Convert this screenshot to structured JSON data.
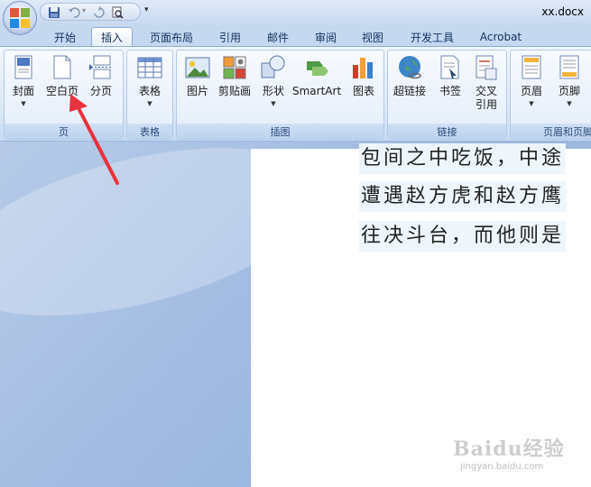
{
  "window": {
    "title": "xx.docx"
  },
  "tabs": [
    {
      "label": "开始"
    },
    {
      "label": "插入"
    },
    {
      "label": "页面布局"
    },
    {
      "label": "引用"
    },
    {
      "label": "邮件"
    },
    {
      "label": "审阅"
    },
    {
      "label": "视图"
    },
    {
      "label": "开发工具"
    },
    {
      "label": "Acrobat"
    }
  ],
  "active_tab": "插入",
  "ribbon": {
    "groups": {
      "pages": {
        "label": "页",
        "cmds": [
          "封面",
          "空白页",
          "分页"
        ]
      },
      "tables": {
        "label": "表格",
        "cmds": [
          "表格"
        ]
      },
      "illustrations": {
        "label": "插图",
        "cmds": [
          "图片",
          "剪贴画",
          "形状",
          "SmartArt",
          "图表"
        ]
      },
      "links": {
        "label": "链接",
        "cmds": [
          "超链接",
          "书签",
          "交叉",
          "引用"
        ]
      },
      "header_footer": {
        "label": "页眉和页脚",
        "cmds": [
          "页眉",
          "页脚"
        ]
      }
    }
  },
  "document": {
    "lines": [
      "包间之中吃饭，中途",
      "遭遇赵方虎和赵方鹰",
      "往决斗台，而他则是"
    ]
  },
  "watermark": {
    "main": "Baidu经验",
    "sub": "jingyan.baidu.com"
  },
  "colors": {
    "arrow": "#e8323c",
    "accent": "#15315e"
  }
}
